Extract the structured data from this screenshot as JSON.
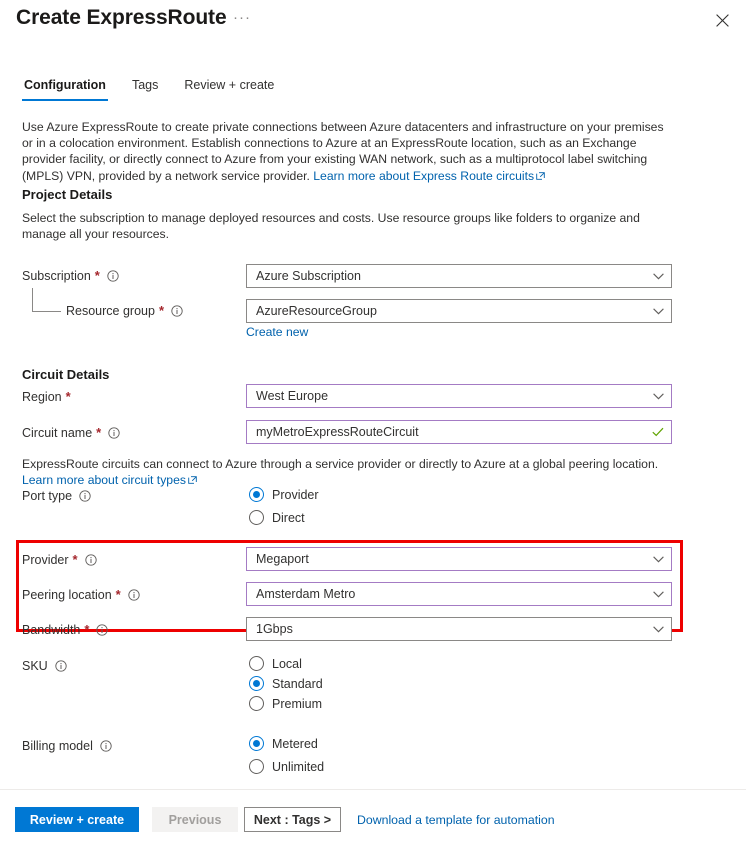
{
  "header": {
    "title": "Create ExpressRoute",
    "ellipsis": "···",
    "close_icon": "close-icon"
  },
  "tabs": [
    {
      "label": "Configuration",
      "active": true
    },
    {
      "label": "Tags",
      "active": false
    },
    {
      "label": "Review + create",
      "active": false
    }
  ],
  "intro": {
    "text": "Use Azure ExpressRoute to create private connections between Azure datacenters and infrastructure on your premises or in a colocation environment. Establish connections to Azure at an ExpressRoute location, such as an Exchange provider facility, or directly connect to Azure from your existing WAN network, such as a multiprotocol label switching (MPLS) VPN, provided by a network service provider. ",
    "link_label": "Learn more about Express Route circuits"
  },
  "project_details": {
    "section_title": "Project Details",
    "helper": "Select the subscription to manage deployed resources and costs. Use resource groups like folders to organize and manage all your resources.",
    "subscription": {
      "label": "Subscription",
      "required": "*",
      "value": "Azure Subscription"
    },
    "resource_group": {
      "label": "Resource group",
      "required": "*",
      "value": "AzureResourceGroup",
      "create_new_label": "Create new"
    }
  },
  "circuit_details": {
    "section_title": "Circuit Details",
    "region": {
      "label": "Region",
      "required": "*",
      "value": "West Europe"
    },
    "circuit_name": {
      "label": "Circuit name",
      "required": "*",
      "value": "myMetroExpressRouteCircuit"
    },
    "circuit_types_note": "ExpressRoute circuits can connect to Azure through a service provider or directly to Azure at a global peering location.",
    "circuit_types_link": "Learn more about circuit types",
    "port_type": {
      "label": "Port type",
      "options": [
        {
          "label": "Provider",
          "selected": true
        },
        {
          "label": "Direct",
          "selected": false
        }
      ]
    },
    "provider": {
      "label": "Provider",
      "required": "*",
      "value": "Megaport"
    },
    "peering_location": {
      "label": "Peering location",
      "required": "*",
      "value": "Amsterdam Metro"
    },
    "bandwidth": {
      "label": "Bandwidth",
      "required": "*",
      "value": "1Gbps"
    },
    "sku": {
      "label": "SKU",
      "options": [
        {
          "label": "Local",
          "selected": false
        },
        {
          "label": "Standard",
          "selected": true
        },
        {
          "label": "Premium",
          "selected": false
        }
      ]
    },
    "billing_model": {
      "label": "Billing model",
      "options": [
        {
          "label": "Metered",
          "selected": true
        },
        {
          "label": "Unlimited",
          "selected": false
        }
      ]
    }
  },
  "footer": {
    "review_create": "Review + create",
    "previous": "Previous",
    "next": "Next : Tags >",
    "download_template": "Download a template for automation"
  },
  "colors": {
    "accent": "#0078d4",
    "link": "#0062ad",
    "required": "#a4262c",
    "highlight": "#ee0000",
    "field_focus_border": "#a47bc4",
    "valid_check": "#5fa300"
  }
}
